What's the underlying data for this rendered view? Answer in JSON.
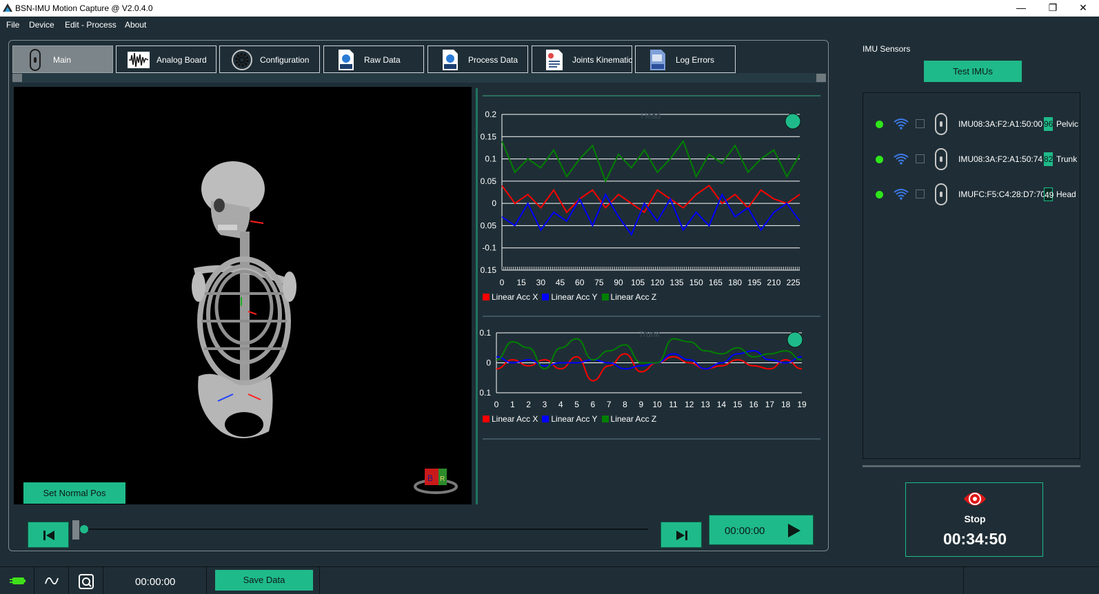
{
  "window": {
    "title": "BSN-IMU Motion Capture @ V2.0.4.0",
    "minimize": "—",
    "restore": "❐",
    "close": "✕"
  },
  "menu": [
    "File",
    "Device",
    "Edit - Process",
    "About"
  ],
  "tabs": [
    {
      "label": "Main",
      "icon": "imu-device-icon",
      "active": true
    },
    {
      "label": "Analog Board",
      "icon": "waveform-icon",
      "active": false
    },
    {
      "label": "Configuration",
      "icon": "gear-icon",
      "active": false
    },
    {
      "label": "Raw Data",
      "icon": "raw-file-icon",
      "active": false
    },
    {
      "label": "Process Data",
      "icon": "raw-file-icon",
      "active": false
    },
    {
      "label": "Joints Kinematic",
      "icon": "report-icon",
      "active": false
    },
    {
      "label": "Log Errors",
      "icon": "log-file-icon",
      "active": false
    }
  ],
  "viewport": {
    "set_normal_pos": "Set Normal Pos",
    "orientation_cube_letters": [
      "B",
      "R"
    ]
  },
  "playback": {
    "time": "00:00:00",
    "position": 0
  },
  "imu_panel": {
    "title": "IMU Sensors",
    "test_button": "Test IMUs",
    "sensors": [
      {
        "mac": "IMU08:3A:F2:A1:50:00",
        "battery": "96",
        "segment": "Pelvic"
      },
      {
        "mac": "IMU08:3A:F2:A1:50:74",
        "battery": "82",
        "segment": "Trunk"
      },
      {
        "mac": "IMUFC:F5:C4:28:D7:70",
        "battery": "49",
        "segment": "Head"
      }
    ]
  },
  "recording": {
    "label": "Stop",
    "elapsed": "00:34:50"
  },
  "statusbar": {
    "time": "00:00:00",
    "save_button": "Save Data"
  },
  "colors": {
    "accent": "#1fba8a",
    "background": "#1f2e36",
    "series_x": "#ff0000",
    "series_y": "#0000ff",
    "series_z": "#008000"
  },
  "chart_data": [
    {
      "type": "line",
      "title": "Head",
      "xlim": [
        0,
        230
      ],
      "ylim": [
        -0.15,
        0.2
      ],
      "xticks": [
        0,
        15,
        30,
        45,
        60,
        75,
        90,
        105,
        120,
        135,
        150,
        165,
        180,
        195,
        210,
        225
      ],
      "yticks": [
        0.2,
        0.15,
        0.1,
        0.05,
        0,
        -0.05,
        -0.1,
        -0.15
      ],
      "ytick_labels": [
        "0.2",
        "0.15",
        "0.1",
        "0.05",
        "0",
        "-0.05",
        "-0.1",
        "-0.15"
      ],
      "grid": true,
      "legend_position": "bottom",
      "x": [
        0,
        10,
        20,
        30,
        40,
        50,
        60,
        70,
        80,
        90,
        100,
        110,
        120,
        130,
        140,
        150,
        160,
        170,
        180,
        190,
        200,
        210,
        220,
        230
      ],
      "series": [
        {
          "name": "Linear Acc X",
          "color": "#ff0000",
          "values": [
            0.04,
            0.0,
            0.02,
            -0.01,
            0.03,
            -0.02,
            0.01,
            0.03,
            -0.01,
            0.02,
            0.0,
            -0.02,
            0.03,
            0.01,
            -0.01,
            0.02,
            0.04,
            0.0,
            0.02,
            -0.01,
            0.03,
            0.01,
            0.0,
            0.02
          ]
        },
        {
          "name": "Linear Acc Y",
          "color": "#0000ff",
          "values": [
            -0.03,
            -0.05,
            0.0,
            -0.06,
            -0.02,
            -0.04,
            0.01,
            -0.05,
            0.02,
            -0.03,
            -0.07,
            0.0,
            -0.04,
            0.01,
            -0.06,
            -0.02,
            -0.05,
            0.02,
            -0.03,
            -0.01,
            -0.06,
            -0.02,
            0.0,
            -0.04
          ]
        },
        {
          "name": "Linear Acc Z",
          "color": "#008000",
          "values": [
            0.14,
            0.07,
            0.1,
            0.08,
            0.12,
            0.06,
            0.1,
            0.13,
            0.05,
            0.11,
            0.08,
            0.12,
            0.07,
            0.1,
            0.14,
            0.06,
            0.11,
            0.09,
            0.13,
            0.07,
            0.1,
            0.12,
            0.06,
            0.11
          ]
        }
      ]
    },
    {
      "type": "line",
      "title": "Trunk",
      "xlim": [
        0,
        19
      ],
      "ylim": [
        -0.1,
        0.1
      ],
      "xticks": [
        0,
        1,
        2,
        3,
        4,
        5,
        6,
        7,
        8,
        9,
        10,
        11,
        12,
        13,
        14,
        15,
        16,
        17,
        18,
        19
      ],
      "yticks": [
        0.1,
        0,
        -0.1
      ],
      "ytick_labels": [
        "0.1",
        "0",
        "-0.1"
      ],
      "grid": true,
      "legend_position": "bottom",
      "x": [
        0,
        1,
        2,
        3,
        4,
        5,
        6,
        7,
        8,
        9,
        10,
        11,
        12,
        13,
        14,
        15,
        16,
        17,
        18,
        19
      ],
      "series": [
        {
          "name": "Linear Acc X",
          "color": "#ff0000",
          "values": [
            -0.02,
            0.01,
            -0.01,
            0.01,
            -0.02,
            0.02,
            -0.06,
            -0.01,
            0.03,
            -0.03,
            0.0,
            0.02,
            0.0,
            -0.02,
            -0.01,
            0.01,
            -0.01,
            -0.02,
            0.01,
            -0.02
          ]
        },
        {
          "name": "Linear Acc Y",
          "color": "#0000ff",
          "values": [
            0.02,
            0.0,
            0.01,
            -0.01,
            0.0,
            0.0,
            0.01,
            0.0,
            -0.02,
            -0.01,
            0.0,
            0.03,
            0.01,
            -0.02,
            0.0,
            0.03,
            0.04,
            0.01,
            0.0,
            0.02
          ]
        },
        {
          "name": "Linear Acc Z",
          "color": "#008000",
          "values": [
            0.01,
            0.07,
            0.05,
            -0.02,
            0.05,
            0.08,
            0.01,
            0.04,
            0.06,
            0.0,
            0.0,
            0.08,
            0.07,
            0.04,
            0.03,
            0.05,
            0.02,
            0.03,
            0.04,
            0.01
          ]
        }
      ]
    }
  ]
}
